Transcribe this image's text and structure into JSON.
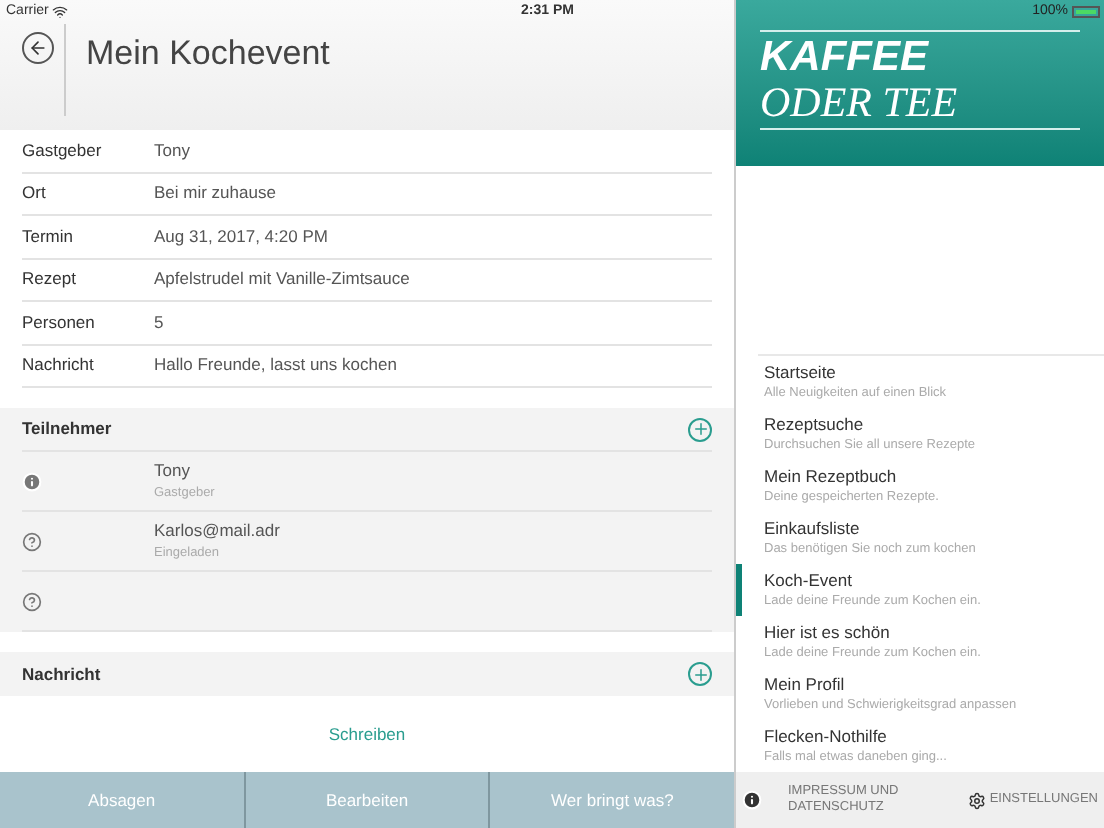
{
  "status_bar": {
    "carrier": "Carrier",
    "time": "2:31 PM",
    "battery": "100%"
  },
  "header": {
    "title": "Mein Kochevent"
  },
  "details": [
    {
      "label": "Gastgeber",
      "value": "Tony"
    },
    {
      "label": "Ort",
      "value": "Bei mir zuhause"
    },
    {
      "label": "Termin",
      "value": "Aug 31, 2017, 4:20 PM"
    },
    {
      "label": "Rezept",
      "value": "Apfelstrudel mit Vanille-Zimtsauce"
    },
    {
      "label": "Personen",
      "value": "5"
    },
    {
      "label": "Nachricht",
      "value": "Hallo Freunde, lasst uns kochen"
    }
  ],
  "participants": {
    "title": "Teilnehmer",
    "items": [
      {
        "kind": "host",
        "name": "Tony",
        "status": "Gastgeber"
      },
      {
        "kind": "invited",
        "name": "Karlos@mail.adr",
        "status": "Eingeladen"
      },
      {
        "kind": "invited"
      }
    ]
  },
  "message": {
    "title": "Nachricht",
    "action": "Schreiben"
  },
  "bottom_buttons": [
    "Absagen",
    "Bearbeiten",
    "Wer bringt was?"
  ],
  "sidebar": {
    "logo": {
      "line1": "KAFFEE",
      "line2": "ODER TEE"
    },
    "items": [
      {
        "title": "Startseite",
        "subtitle": "Alle Neuigkeiten auf einen Blick",
        "selected": false
      },
      {
        "title": "Rezeptsuche",
        "subtitle": "Durchsuchen Sie all unsere Rezepte",
        "selected": false
      },
      {
        "title": "Mein Rezeptbuch",
        "subtitle": "Deine gespeicherten Rezepte.",
        "selected": false
      },
      {
        "title": "Einkaufsliste",
        "subtitle": "Das benötigen Sie noch zum kochen",
        "selected": false
      },
      {
        "title": "Koch-Event",
        "subtitle": "Lade deine Freunde zum Kochen ein.",
        "selected": true
      },
      {
        "title": "Hier ist es schön",
        "subtitle": "Lade deine Freunde zum Kochen ein.",
        "selected": false
      },
      {
        "title": "Mein Profil",
        "subtitle": "Vorlieben und Schwierigkeitsgrad anpassen",
        "selected": false
      },
      {
        "title": "Flecken-Nothilfe",
        "subtitle": "Falls mal etwas daneben ging...",
        "selected": false
      }
    ],
    "footer": {
      "imprint": "IMPRESSUM UND DATENSCHUTZ",
      "settings": "EINSTELLUNGEN"
    }
  }
}
